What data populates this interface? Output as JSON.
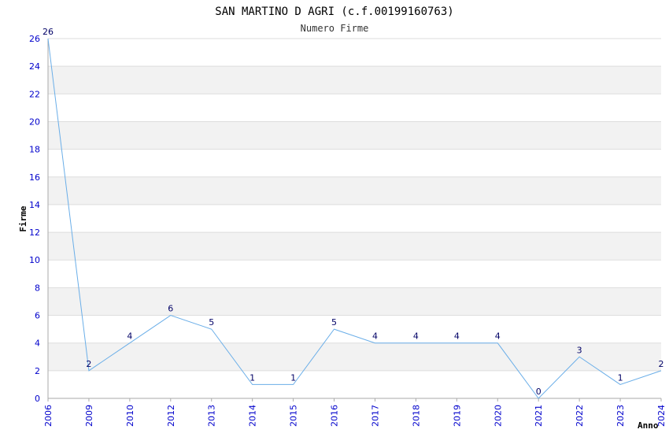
{
  "chart_data": {
    "type": "line",
    "title": "SAN MARTINO D AGRI (c.f.00199160763)",
    "subtitle": "Numero Firme",
    "xlabel": "Anno",
    "ylabel": "Firme",
    "categories": [
      "2006",
      "2009",
      "2010",
      "2012",
      "2013",
      "2014",
      "2015",
      "2016",
      "2017",
      "2018",
      "2019",
      "2020",
      "2021",
      "2022",
      "2023",
      "2024"
    ],
    "series": [
      {
        "values": [
          26,
          2,
          4,
          6,
          5,
          1,
          1,
          5,
          4,
          4,
          4,
          4,
          0,
          3,
          1,
          2
        ]
      }
    ],
    "data_labels": [
      "26",
      "2",
      "4",
      "6",
      "5",
      "1",
      "1",
      "5",
      "4",
      "4",
      "4",
      "4",
      "0",
      "3",
      "1",
      "2"
    ],
    "y_ticks": [
      "0",
      "2",
      "4",
      "6",
      "8",
      "10",
      "12",
      "14",
      "16",
      "18",
      "20",
      "22",
      "24",
      "26"
    ],
    "ylim": [
      0,
      26
    ],
    "grid": true,
    "legend": "none",
    "colors": {
      "line": "#6aaee8",
      "band": "#f2f2f2",
      "gridline": "#dddddd",
      "axis": "#aaaaaa",
      "tick_text": "#0000cc",
      "label_text": "#000066"
    }
  }
}
